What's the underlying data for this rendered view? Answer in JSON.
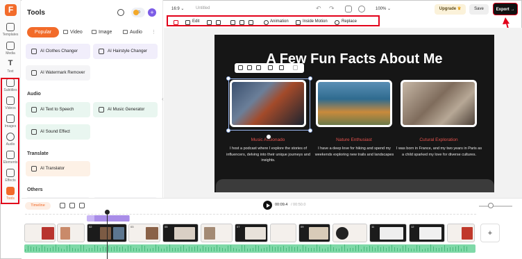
{
  "rail": {
    "items": [
      {
        "label": "Templates"
      },
      {
        "label": "Media"
      },
      {
        "label": "Text"
      },
      {
        "label": "Subtitles"
      },
      {
        "label": "Videos"
      },
      {
        "label": "Images"
      },
      {
        "label": "Audio"
      },
      {
        "label": "Elements"
      },
      {
        "label": "Effects"
      },
      {
        "label": "Tools"
      }
    ],
    "active": "Tools"
  },
  "tools": {
    "title": "Tools",
    "coins": "0",
    "tabs": [
      "Popular",
      "Video",
      "Image",
      "Audio"
    ],
    "cards_top": [
      "AI Clothes Changer",
      "AI Hairstyle Changer",
      "AI Watermark Remover"
    ],
    "sections": {
      "audio": {
        "title": "Audio",
        "items": [
          "AI Text to Speech",
          "AI Music Generator",
          "AI Sound Effect"
        ]
      },
      "translate": {
        "title": "Translate",
        "items": [
          "AI Translator"
        ]
      },
      "others": {
        "title": "Others"
      }
    }
  },
  "topbar": {
    "ratio": "16:9",
    "title": "Untitled",
    "zoom": "100%",
    "upgrade": "Upgrade",
    "save": "Save",
    "export": "Export"
  },
  "edit_toolbar": {
    "edit": "Edit",
    "animation": "Animation",
    "inside_motion": "Inside Motion",
    "replace": "Replace"
  },
  "slide": {
    "title": "A Few Fun Facts About Me",
    "cards": [
      {
        "name": "Music Aficionado",
        "desc": "I host a podcast where I explore the stories of influencers, delving into their unique journeys and insights."
      },
      {
        "name": "Nature Enthusiast",
        "desc": "I have a deep love for hiking and spend my weekends exploring new trails and landscapes"
      },
      {
        "name": "Cutural Exploration",
        "desc": "I was born in France, and my two years in Paris as a child sparked my love for diverse cultures."
      }
    ]
  },
  "timeline": {
    "label": "Timeline",
    "current": "00:09.4",
    "total": "/ 00:50.0",
    "clip_numbers": [
      "02",
      "03",
      "05",
      "07",
      "09",
      "11",
      "12"
    ],
    "add": "+"
  },
  "colors": {
    "brand": "#f26b2a",
    "annotation_red": "#e2001a",
    "accent_purple": "#7c5ce6",
    "slide_bg": "#161616",
    "slide_accent": "#e8534e",
    "waveform": "#7fd9a8"
  }
}
